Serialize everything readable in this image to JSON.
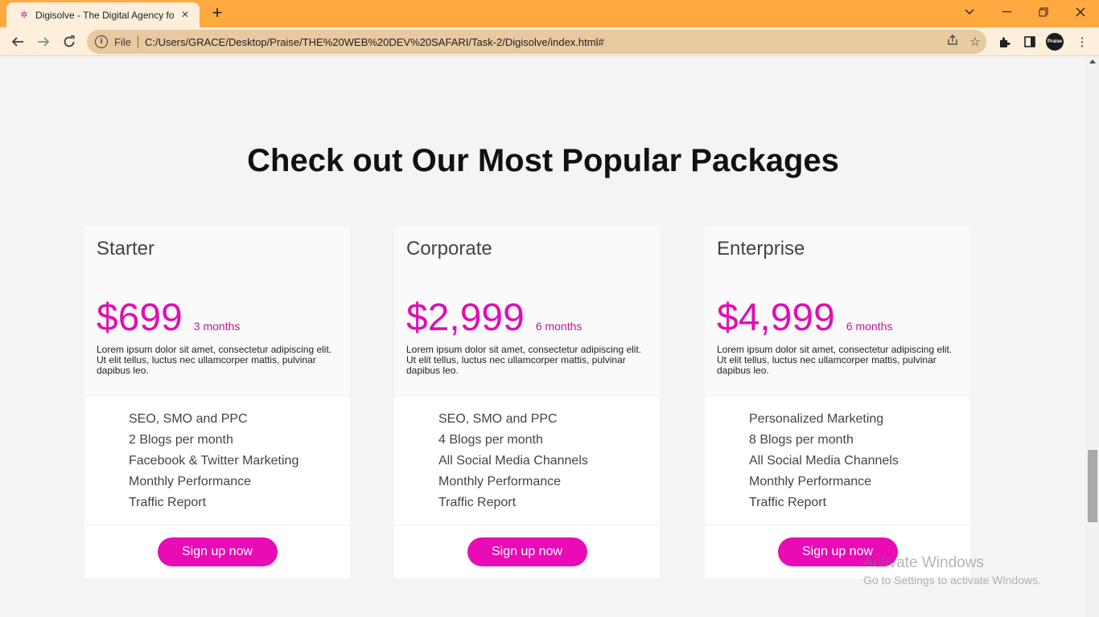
{
  "browser": {
    "tab_title": "Digisolve - The Digital Agency fo",
    "url_scheme": "File",
    "url": "C:/Users/GRACE/Desktop/Praise/THE%20WEB%20DEV%20SAFARI/Task-2/Digisolve/index.html#",
    "profile_label": "Praise"
  },
  "section": {
    "heading": "Check out Our Most Popular Packages"
  },
  "packages": [
    {
      "name": "Starter",
      "price": "$699",
      "period": "3 months",
      "description": "Lorem ipsum dolor sit amet, consectetur adipiscing elit. Ut elit tellus, luctus nec ullamcorper mattis, pulvinar dapibus leo.",
      "features": [
        "SEO, SMO and PPC",
        "2 Blogs per month",
        "Facebook & Twitter Marketing",
        "Monthly Performance",
        "Traffic Report"
      ],
      "cta": "Sign up now"
    },
    {
      "name": "Corporate",
      "price": "$2,999",
      "period": "6 months",
      "description": "Lorem ipsum dolor sit amet, consectetur adipiscing elit. Ut elit tellus, luctus nec ullamcorper mattis, pulvinar dapibus leo.",
      "features": [
        "SEO, SMO and PPC",
        "4 Blogs per month",
        "All Social Media Channels",
        "Monthly Performance",
        "Traffic Report"
      ],
      "cta": "Sign up now"
    },
    {
      "name": "Enterprise",
      "price": "$4,999",
      "period": "6 months",
      "description": "Lorem ipsum dolor sit amet, consectetur adipiscing elit. Ut elit tellus, luctus nec ullamcorper mattis, pulvinar dapibus leo.",
      "features": [
        "Personalized Marketing",
        "8 Blogs per month",
        "All Social Media Channels",
        "Monthly Performance",
        "Traffic Report"
      ],
      "cta": "Sign up now"
    }
  ],
  "watermark": {
    "line1": "Activate Windows",
    "line2": "Go to Settings to activate Windows."
  },
  "colors": {
    "accent": "#e80bb6",
    "price": "#e00fb4",
    "tab_bar": "#ffa940"
  }
}
